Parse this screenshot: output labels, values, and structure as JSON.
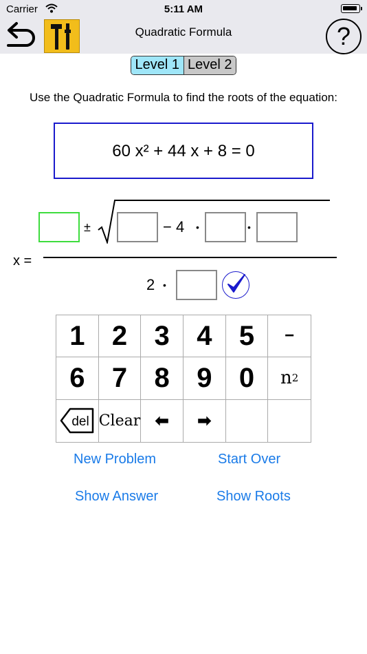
{
  "status_bar": {
    "carrier": "Carrier",
    "time": "5:11 AM"
  },
  "nav": {
    "title": "Quadratic Formula",
    "help_label": "?"
  },
  "levels": {
    "level1": "Level 1",
    "level2": "Level 2",
    "selected": "Level 1"
  },
  "instruction": "Use the Quadratic Formula to find the roots of the equation:",
  "equation": "60 x² + 44 x + 8 = 0",
  "formula": {
    "x_label": "x =",
    "plus_minus": "±",
    "minus_four": "− 4",
    "dot": "•",
    "two": "2",
    "box_b_value": "",
    "box_b2_value": "",
    "box_a_value": "",
    "box_c_value": "",
    "box_2a_value": ""
  },
  "keypad": {
    "keys": [
      "1",
      "2",
      "3",
      "4",
      "5",
      "−",
      "6",
      "7",
      "8",
      "9",
      "0",
      "n",
      "del",
      "Clear",
      "⬅",
      "➡",
      "",
      ""
    ],
    "square_label": "n",
    "square_sup": "2"
  },
  "actions": {
    "new_problem": "New Problem",
    "start_over": "Start Over",
    "show_answer": "Show Answer",
    "show_roots": "Show Roots"
  },
  "colors": {
    "bar_bg": "#e9e9ee",
    "tools_bg": "#f2bd1b",
    "level_selected": "#9fe6f8",
    "equation_border": "#1a1acc",
    "active_box": "#3ddc3d",
    "link": "#1a7be8"
  },
  "icons": {
    "back": "undo-arrow-icon",
    "tools": "hammer-screwdriver-icon",
    "check": "checkmark-icon"
  }
}
